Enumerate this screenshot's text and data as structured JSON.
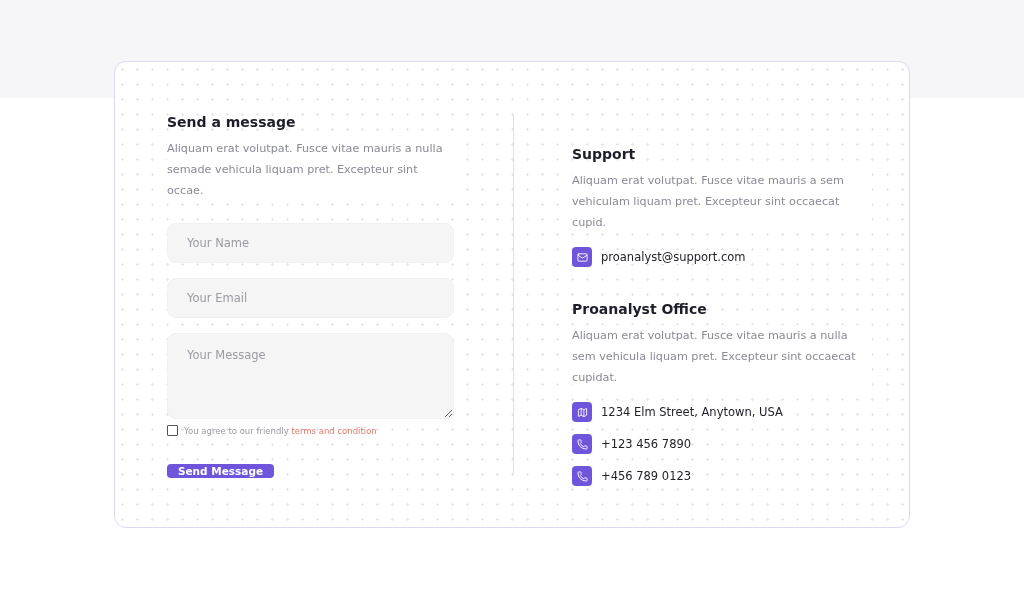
{
  "form": {
    "title": "Send a message",
    "description": "Aliquam erat volutpat. Fusce vitae mauris a nulla semade vehicula liquam pret. Excepteur sint occae.",
    "fields": [
      {
        "kind": "input",
        "placeholder": "Your Name"
      },
      {
        "kind": "input",
        "placeholder": "Your Email"
      },
      {
        "kind": "textarea",
        "placeholder": "Your Message"
      }
    ],
    "agreement": {
      "checked": false,
      "text": "You agree to our friendly",
      "link": "terms and condition"
    },
    "submit": "Send Message"
  },
  "sections": [
    {
      "title": "Support",
      "description": "Aliquam erat volutpat. Fusce vitae mauris a sem vehiculam liquam pret. Excepteur sint occaecat cupid.",
      "contacts": [
        {
          "kind": "email",
          "text": "proanalyst@support.com"
        }
      ]
    },
    {
      "title": "Proanalyst Office",
      "description": "Aliquam erat volutpat. Fusce vitae mauris a nulla sem vehicula liquam pret. Excepteur sint occaecat cupidat.",
      "contacts": [
        {
          "kind": "map",
          "text": "1234 Elm Street, Anytown, USA"
        },
        {
          "kind": "phone",
          "text": "+123 456 7890"
        },
        {
          "kind": "phone",
          "text": "+456 789 0123"
        }
      ]
    }
  ]
}
